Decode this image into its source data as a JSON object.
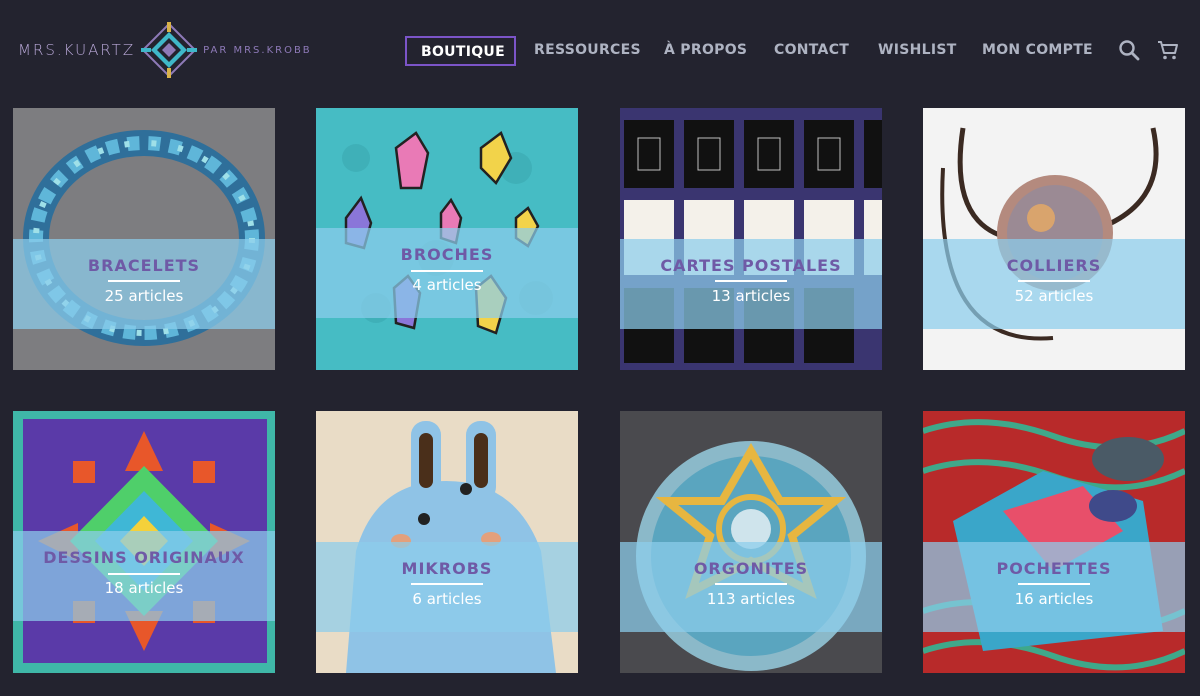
{
  "header": {
    "logo_main": "MRS.KUARTZ",
    "logo_sub": "PAR MRS.KROBB",
    "logo_mark_icon": "geometric-diamond-logo-icon"
  },
  "nav": {
    "items": [
      {
        "label": "BOUTIQUE",
        "active": true
      },
      {
        "label": "RESSOURCES",
        "active": false
      },
      {
        "label": "À PROPOS",
        "active": false
      },
      {
        "label": "CONTACT",
        "active": false
      },
      {
        "label": "WISHLIST",
        "active": false
      },
      {
        "label": "MON COMPTE",
        "active": false
      }
    ],
    "search_icon": "search-icon",
    "cart_icon": "cart-icon"
  },
  "categories": [
    {
      "title": "BRACELETS",
      "count": "25 articles"
    },
    {
      "title": "BROCHES",
      "count": "4 articles"
    },
    {
      "title": "CARTES POSTALES",
      "count": "13 articles"
    },
    {
      "title": "COLLIERS",
      "count": "52 articles"
    },
    {
      "title": "DESSINS ORIGINAUX",
      "count": "18 articles"
    },
    {
      "title": "MIKROBS",
      "count": "6 articles"
    },
    {
      "title": "ORGONITES",
      "count": "113 articles"
    },
    {
      "title": "POCHETTES",
      "count": "16 articles"
    }
  ],
  "colors": {
    "background": "#23232f",
    "accent": "#7b54c8",
    "nav_text": "#aeb3c2",
    "tile_band": "#8ccdeb",
    "tile_title": "#6f5aa6"
  }
}
